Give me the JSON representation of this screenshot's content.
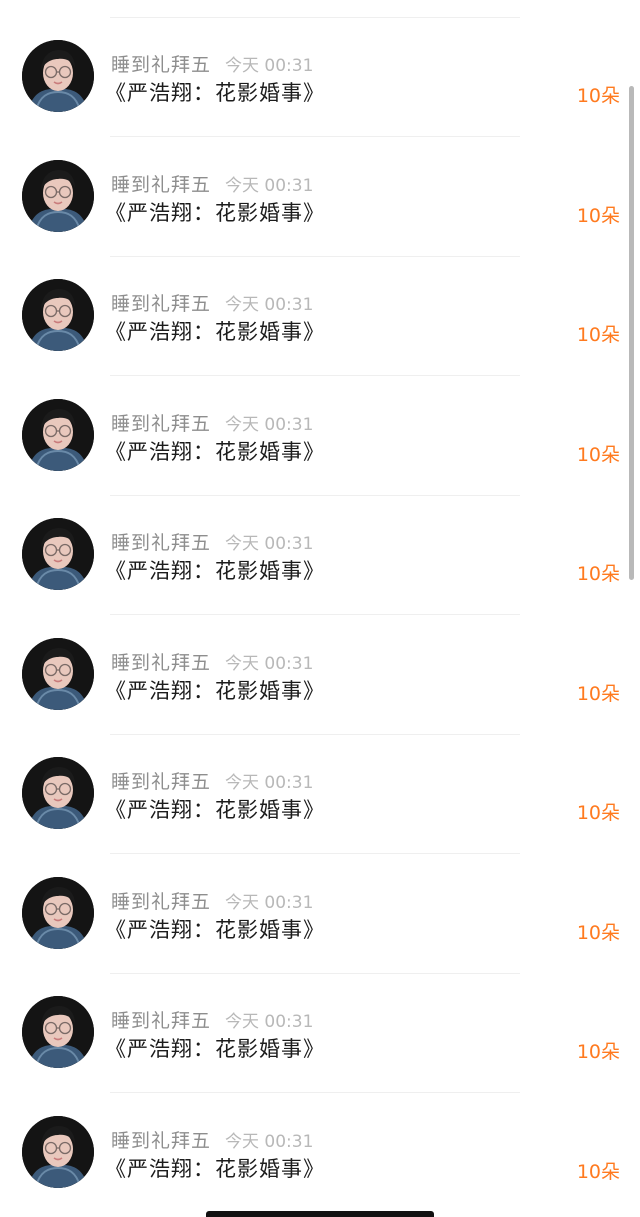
{
  "colors": {
    "count_accent": "#ff7a1f",
    "username": "#8e8e8e",
    "time": "#b8b8b8",
    "title": "#1c1c1c"
  },
  "rows": [
    {
      "avatar": "user-avatar-photo",
      "username": "睡到礼拜五",
      "time": "今天 00:31",
      "title": "《严浩翔：花影婚事》",
      "count": "10朵"
    },
    {
      "avatar": "user-avatar-photo",
      "username": "睡到礼拜五",
      "time": "今天 00:31",
      "title": "《严浩翔：花影婚事》",
      "count": "10朵"
    },
    {
      "avatar": "user-avatar-photo",
      "username": "睡到礼拜五",
      "time": "今天 00:31",
      "title": "《严浩翔：花影婚事》",
      "count": "10朵"
    },
    {
      "avatar": "user-avatar-photo",
      "username": "睡到礼拜五",
      "time": "今天 00:31",
      "title": "《严浩翔：花影婚事》",
      "count": "10朵"
    },
    {
      "avatar": "user-avatar-photo",
      "username": "睡到礼拜五",
      "time": "今天 00:31",
      "title": "《严浩翔：花影婚事》",
      "count": "10朵"
    },
    {
      "avatar": "user-avatar-photo",
      "username": "睡到礼拜五",
      "time": "今天 00:31",
      "title": "《严浩翔：花影婚事》",
      "count": "10朵"
    },
    {
      "avatar": "user-avatar-photo",
      "username": "睡到礼拜五",
      "time": "今天 00:31",
      "title": "《严浩翔：花影婚事》",
      "count": "10朵"
    },
    {
      "avatar": "user-avatar-photo",
      "username": "睡到礼拜五",
      "time": "今天 00:31",
      "title": "《严浩翔：花影婚事》",
      "count": "10朵"
    },
    {
      "avatar": "user-avatar-photo",
      "username": "睡到礼拜五",
      "time": "今天 00:31",
      "title": "《严浩翔：花影婚事》",
      "count": "10朵"
    },
    {
      "avatar": "user-avatar-photo",
      "username": "睡到礼拜五",
      "time": "今天 00:31",
      "title": "《严浩翔：花影婚事》",
      "count": "10朵"
    }
  ]
}
